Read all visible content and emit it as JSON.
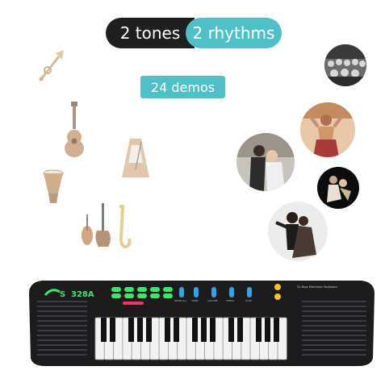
{
  "banner": {
    "tones_label": "2 tones",
    "rhythms_label": "2 rhythms",
    "demos_label": "24 demos"
  },
  "keyboard": {
    "brand_logo_text": "S",
    "model_text": "328A",
    "panel_title": "31 Keys Electronic Keyboard",
    "control_labels": [
      "DEMO ALL",
      "TONE",
      "VOLUME",
      "TEMPO",
      "STOP"
    ],
    "red_button_label": "DEMO ONE"
  },
  "icons": [
    "trumpet-icon",
    "guitar-icon",
    "metronome-icon",
    "drum-icon",
    "violin-guitar-saxophone-icon"
  ],
  "colors": {
    "dark_pill": "#1f1f1f",
    "teal_pill": "#4fc0c8",
    "keyboard_body": "#1c1c1e",
    "green_button": "#3ee66a",
    "blue_button": "#2fa4e8",
    "yellow_button": "#f2c230"
  }
}
